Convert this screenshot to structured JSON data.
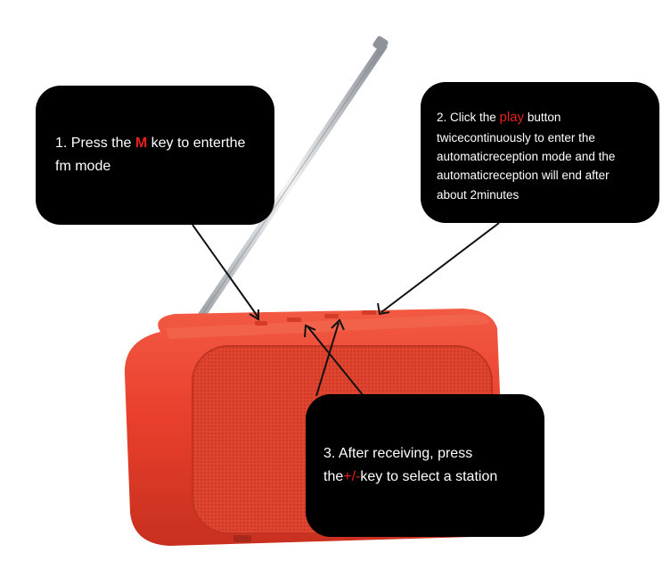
{
  "colors": {
    "callout_bg": "#000000",
    "callout_text": "#ffffff",
    "highlight": "#e8201c",
    "speaker_body": "#e9402d",
    "speaker_grille": "#e0442f",
    "antenna": "#c8ccd0"
  },
  "callouts": {
    "step1": {
      "prefix": "1. Press the ",
      "key": "M",
      "suffix_line1": " key to enterthe",
      "line2": "fm mode"
    },
    "step2": {
      "prefix": "2. Click the ",
      "key": "play",
      "suffix_line1": " button",
      "line2": "twicecontinuously to enter the",
      "line3": "automaticreception mode and the",
      "line4": "automaticreception will end after",
      "line5": "about 2minutes"
    },
    "step3": {
      "line1": "3. After receiving, press",
      "prefix2": "the",
      "key": "+/-",
      "suffix2": "key to select a station"
    }
  },
  "image": {
    "subject": "red portable speaker",
    "parts": [
      "telescopic-antenna",
      "top-buttons",
      "front-grille"
    ]
  }
}
